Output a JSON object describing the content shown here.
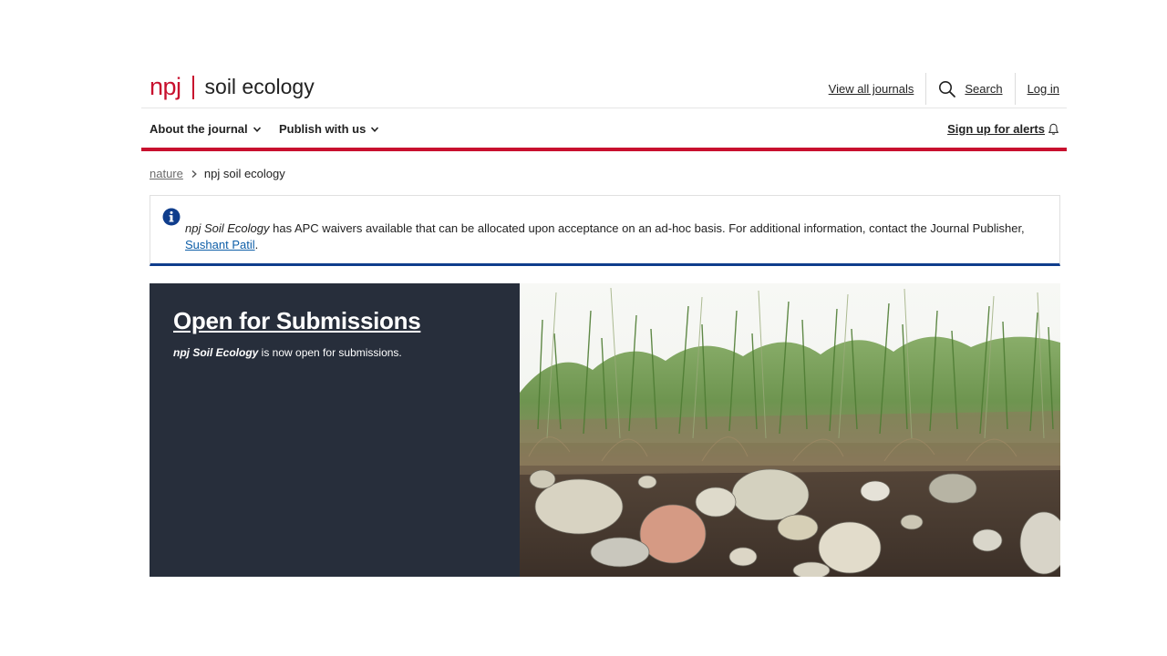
{
  "header": {
    "logo_npj": "npj",
    "logo_name": "soil ecology",
    "view_all_journals": "View all journals",
    "search_label": "Search",
    "login_label": "Log in"
  },
  "nav": {
    "about": "About the journal",
    "publish": "Publish with us",
    "alerts": "Sign up for alerts"
  },
  "breadcrumb": {
    "root": "nature",
    "current": "npj soil ecology"
  },
  "notice": {
    "journal_name": "npj Soil Ecology",
    "text": " has APC waivers available that can be allocated upon acceptance on an ad-hoc basis. For additional information, contact the Journal Publisher, ",
    "link": "Sushant Patil",
    "end": "."
  },
  "hero": {
    "title": "Open for Submissions",
    "journal_name": "npj Soil Ecology",
    "subtitle": " is now open for submissions."
  },
  "colors": {
    "brand_red": "#c8102e",
    "panel_dark": "#272e3b",
    "notice_border": "#0f3d8c",
    "link_blue": "#0f5fa8"
  },
  "icons": {
    "search": "search-icon",
    "chevron": "chevron-down-icon",
    "bell": "bell-icon",
    "info": "info-icon",
    "breadcrumb_separator": "chevron-right-icon"
  }
}
